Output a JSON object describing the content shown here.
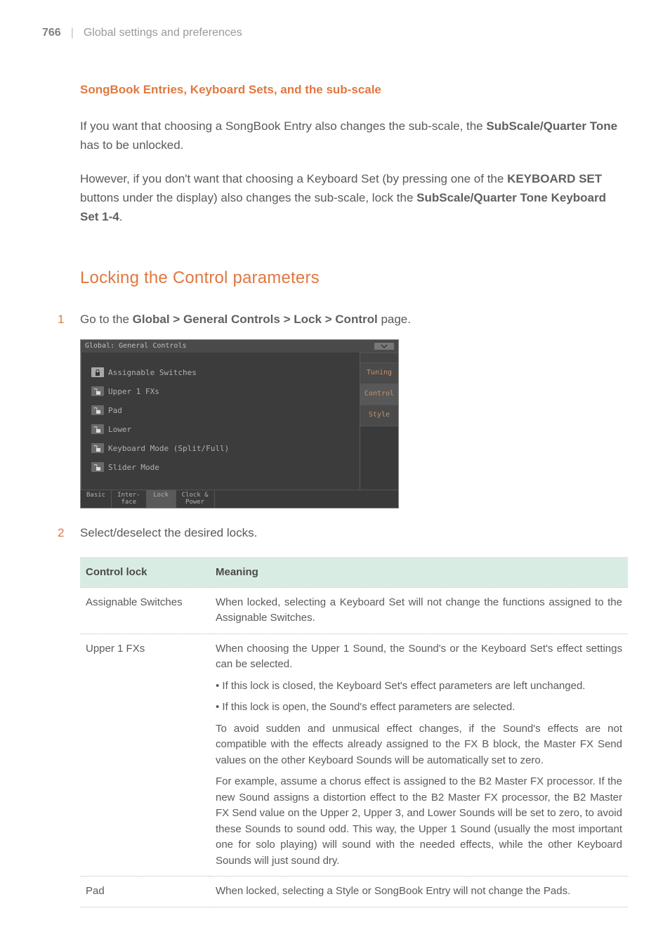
{
  "header": {
    "page_number": "766",
    "separator": "|",
    "running_head": "Global settings and preferences"
  },
  "section_a": {
    "title": "SongBook Entries, Keyboard Sets, and the sub-scale",
    "para1_a": "If you want that choosing a SongBook Entry also changes the sub-scale, the ",
    "para1_b": "SubScale/Quarter Tone",
    "para1_c": " has to be unlocked.",
    "para2_a": "However, if you don't want that choosing a Keyboard Set (by pressing one of the ",
    "para2_b": "KEYBOARD SET",
    "para2_c": " buttons under the display) also changes the sub-scale, lock the ",
    "para2_d": "SubScale/Quarter Tone Keyboard Set 1-4",
    "para2_e": "."
  },
  "section_b": {
    "heading": "Locking the Control parameters",
    "step1_num": "1",
    "step1_a": "Go to the ",
    "step1_b": "Global > General Controls > Lock > Control",
    "step1_c": " page.",
    "step2_num": "2",
    "step2_text": "Select/deselect the desired locks."
  },
  "device": {
    "title": "Global: General Controls",
    "lock_rows": {
      "r0": {
        "label": "Assignable Switches",
        "locked": true
      },
      "r1": {
        "label": "Upper 1 FXs",
        "locked": false
      },
      "r2": {
        "label": "Pad",
        "locked": false
      },
      "r3": {
        "label": "Lower",
        "locked": false
      },
      "r4": {
        "label": "Keyboard Mode (Split/Full)",
        "locked": false
      },
      "r5": {
        "label": "Slider Mode",
        "locked": false
      }
    },
    "side_tabs": {
      "t0": "Tuning",
      "t1": "Control",
      "t2": "Style"
    },
    "bottom_tabs": {
      "b0": "Basic",
      "b1": "Inter-\nface",
      "b2": "Lock",
      "b3": "Clock &\nPower"
    }
  },
  "table": {
    "head": {
      "c0": "Control lock",
      "c1": "Meaning"
    },
    "rows": {
      "r0": {
        "name": "Assignable Switches",
        "p0": "When locked, selecting a Keyboard Set will not change the functions assigned to the Assignable Switches."
      },
      "r1": {
        "name": "Upper 1 FXs",
        "p0": "When choosing the Upper 1 Sound, the Sound's or the Keyboard Set's effect settings can be selected.",
        "p1": "• If this lock is closed, the Keyboard Set's effect parameters are left unchanged.",
        "p2": "• If this lock is open, the Sound's effect parameters are selected.",
        "p3": "To avoid sudden and unmusical effect changes, if the Sound's effects are not compatible with the effects already assigned to the FX B block, the Master FX Send values on the other Keyboard Sounds will be automatically set to zero.",
        "p4": "For example, assume a chorus effect is assigned to the B2 Master FX processor. If the new Sound assigns a distortion effect to the B2 Master FX processor, the B2 Master FX Send value on the Upper 2, Upper 3, and Lower Sounds will be set to zero, to avoid these Sounds to sound odd. This way, the Upper 1 Sound (usually the most important one for solo playing) will sound with the needed effects, while the other Keyboard Sounds will just sound dry."
      },
      "r2": {
        "name": "Pad",
        "p0": "When locked, selecting a Style or SongBook Entry will not change the Pads."
      }
    }
  }
}
